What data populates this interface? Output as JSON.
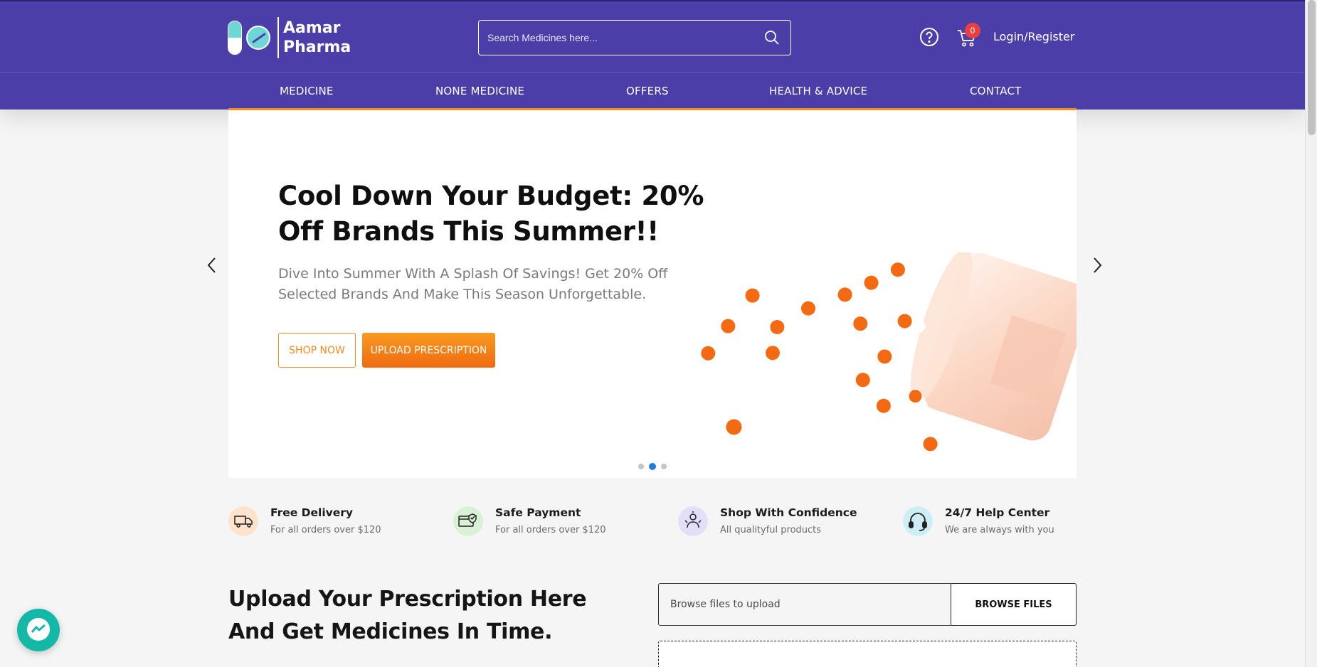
{
  "brand": {
    "name_line1": "Aamar",
    "name_line2": "Pharma",
    "logo_icon": "capsule-pill-logo"
  },
  "search": {
    "placeholder": "Search Medicines here...",
    "icon": "search-icon"
  },
  "header_actions": {
    "help_icon": "question-circle-icon",
    "cart_icon": "shopping-cart-icon",
    "cart_count": "0",
    "login_label": "Login/Register"
  },
  "nav": {
    "items": [
      {
        "label": "MEDICINE"
      },
      {
        "label": "NONE MEDICINE"
      },
      {
        "label": "OFFERS"
      },
      {
        "label": "HEALTH & ADVICE"
      },
      {
        "label": "CONTACT"
      }
    ]
  },
  "hero": {
    "title": "Cool Down Your Budget: 20% Off Brands This Summer!!",
    "subtitle": "Dive Into Summer With A Splash Of Savings! Get 20% Off Selected Brands And Make This Season Unforgettable.",
    "shop_label": "SHOP NOW",
    "upload_label": "UPLOAD PRESCRIPTION",
    "slide_count": 3,
    "active_slide": 2,
    "image": "spilled-orange-capsules-bottle"
  },
  "features": [
    {
      "title": "Free Delivery",
      "text": "For all orders over $120",
      "icon": "delivery-truck-icon",
      "bg": "#fde3cc"
    },
    {
      "title": "Safe Payment",
      "text": "For all orders over $120",
      "icon": "secure-card-icon",
      "bg": "#d8f2d6"
    },
    {
      "title": "Shop With Confidence",
      "text": "All qualityful products",
      "icon": "shield-check-icon",
      "bg": "#e3defa"
    },
    {
      "title": "24/7 Help Center",
      "text": "We are always with you",
      "icon": "headset-icon",
      "bg": "#cdeef5"
    }
  ],
  "upload": {
    "heading": "Upload Your Prescription Here And Get Medicines In Time.",
    "input_placeholder": "Browse files to upload",
    "browse_label": "BROWSE FILES"
  },
  "chat": {
    "icon": "messenger-icon"
  },
  "colors": {
    "header": "#4b3ea8",
    "accent": "#f58a1f",
    "badge": "#e8403c",
    "dot_active": "#1e7ae0"
  }
}
